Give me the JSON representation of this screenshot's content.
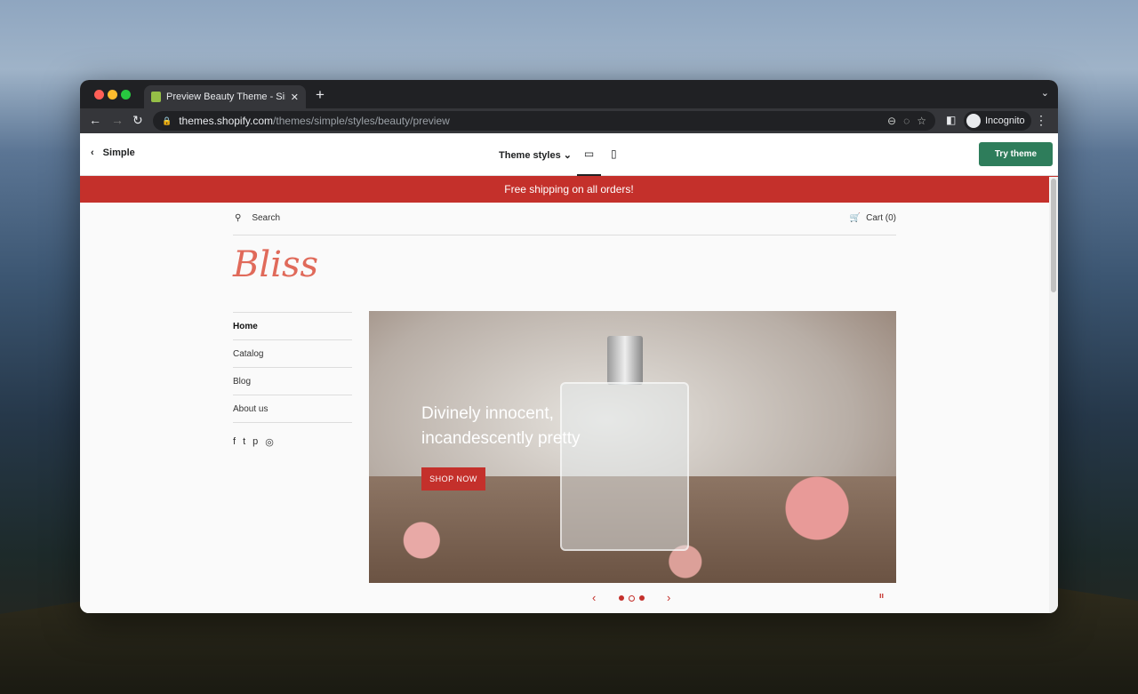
{
  "browser": {
    "tab_title": "Preview Beauty Theme - Simple",
    "url_host": "themes.shopify.com",
    "url_path": "/themes/simple/styles/beauty/preview",
    "profile": "Incognito"
  },
  "preview_bar": {
    "back_label": "Simple",
    "theme_styles": "Theme styles",
    "try_button": "Try theme",
    "accent": "#2e7d5b"
  },
  "store": {
    "banner": "Free shipping on all orders!",
    "banner_color": "#c4302b",
    "search_placeholder": "Search",
    "cart": "Cart (0)",
    "logo": "Bliss",
    "nav": [
      {
        "label": "Home",
        "active": true
      },
      {
        "label": "Catalog"
      },
      {
        "label": "Blog"
      },
      {
        "label": "About us"
      }
    ],
    "social": [
      "facebook-icon",
      "twitter-icon",
      "pinterest-icon",
      "instagram-icon"
    ],
    "hero": {
      "line1": "Divinely innocent,",
      "line2": "incandescently pretty",
      "button": "SHOP NOW"
    },
    "slider": {
      "slides": 3,
      "current": 2
    }
  }
}
